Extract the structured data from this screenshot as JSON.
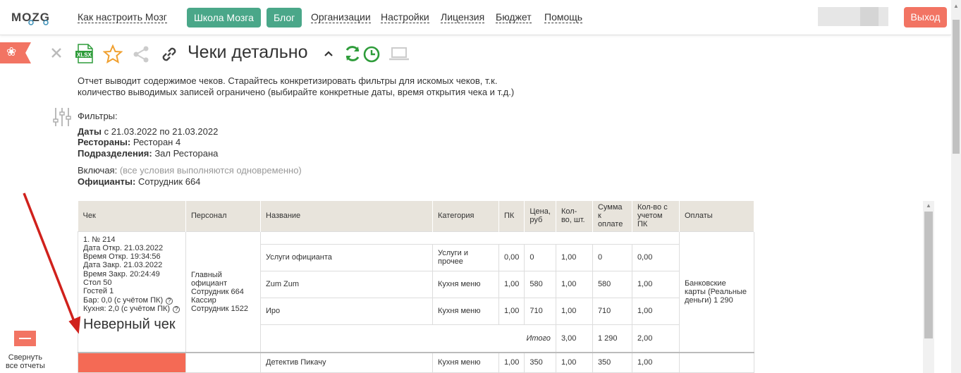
{
  "logo": "MOZG",
  "nav": {
    "how_to": "Как настроить Мозг",
    "school": "Школа Мозга",
    "blog": "Блог",
    "orgs": "Организации",
    "settings": "Настройки",
    "license": "Лицензия",
    "budget": "Бюджет",
    "help": "Помощь",
    "exit": "Выход"
  },
  "report": {
    "title": "Чеки детально",
    "description": "Отчет выводит содержимое чеков. Старайтесь конкретизировать фильтры для искомых чеков, т.к. количество выводимых записей ограничено (выбирайте конкретные даты, время открытия чека и т.д.)",
    "filters_label": "Фильтры:",
    "dates_label": "Даты",
    "dates_value": " с 21.03.2022 по 21.03.2022",
    "restaurants_label": "Рестораны:",
    "restaurants_value": " Ресторан 4",
    "divisions_label": "Подразделения:",
    "divisions_value": " Зал Ресторана",
    "including_label": "Включая:",
    "including_note": " (все условия выполняются одновременно)",
    "waiters_label": "Официанты:",
    "waiters_value": " Сотрудник 664"
  },
  "sidebar": {
    "collapse_label_1": "Свернуть",
    "collapse_label_2": "все отчеты"
  },
  "table": {
    "headers": [
      "Чек",
      "Персонал",
      "Название",
      "Категория",
      "ПК",
      "Цена, руб",
      "Кол-во, шт.",
      "Сумма к оплате",
      "Кол-во с учетом ПК",
      "Оплаты"
    ],
    "cheque": {
      "lines": [
        "1. № 214",
        "Дата Откр. 21.03.2022",
        "Время Откр. 19:34:56",
        "Дата Закр. 21.03.2022",
        "Время Закр. 20:24:49",
        "Стол 50",
        "Гостей 1"
      ],
      "bar": "Бар: 0,0 (с учётом ПК)",
      "kitchen": "Кухня: 2,0 (с учётом ПК)",
      "wrong": "Неверный чек"
    },
    "staff": "Главный официант Сотрудник 664 Кассир Сотрудник 1522",
    "payment": "Банковские карты (Реальные деньги) 1 290",
    "rows": [
      {
        "name": "Услуги официанта",
        "cat": "Услуги и прочее",
        "pk": "0,00",
        "price": "0",
        "qty": "1,00",
        "sum": "0",
        "qty_pk": "0,00"
      },
      {
        "name": "Zum Zum",
        "cat": "Кухня меню",
        "pk": "1,00",
        "price": "580",
        "qty": "1,00",
        "sum": "580",
        "qty_pk": "1,00"
      },
      {
        "name": "Иро",
        "cat": "Кухня меню",
        "pk": "1,00",
        "price": "710",
        "qty": "1,00",
        "sum": "710",
        "qty_pk": "1,00"
      }
    ],
    "total": {
      "label": "Итого",
      "qty": "3,00",
      "sum": "1 290",
      "qty_pk": "2,00"
    },
    "next_row": {
      "name": "Детектив Пикачу",
      "cat": "Кухня меню",
      "pk": "1,00",
      "price": "350",
      "qty": "1,00",
      "sum": "350",
      "qty_pk": "1,00"
    }
  },
  "colors": {
    "accent_green": "#4aa789",
    "accent_red": "#f27463"
  }
}
